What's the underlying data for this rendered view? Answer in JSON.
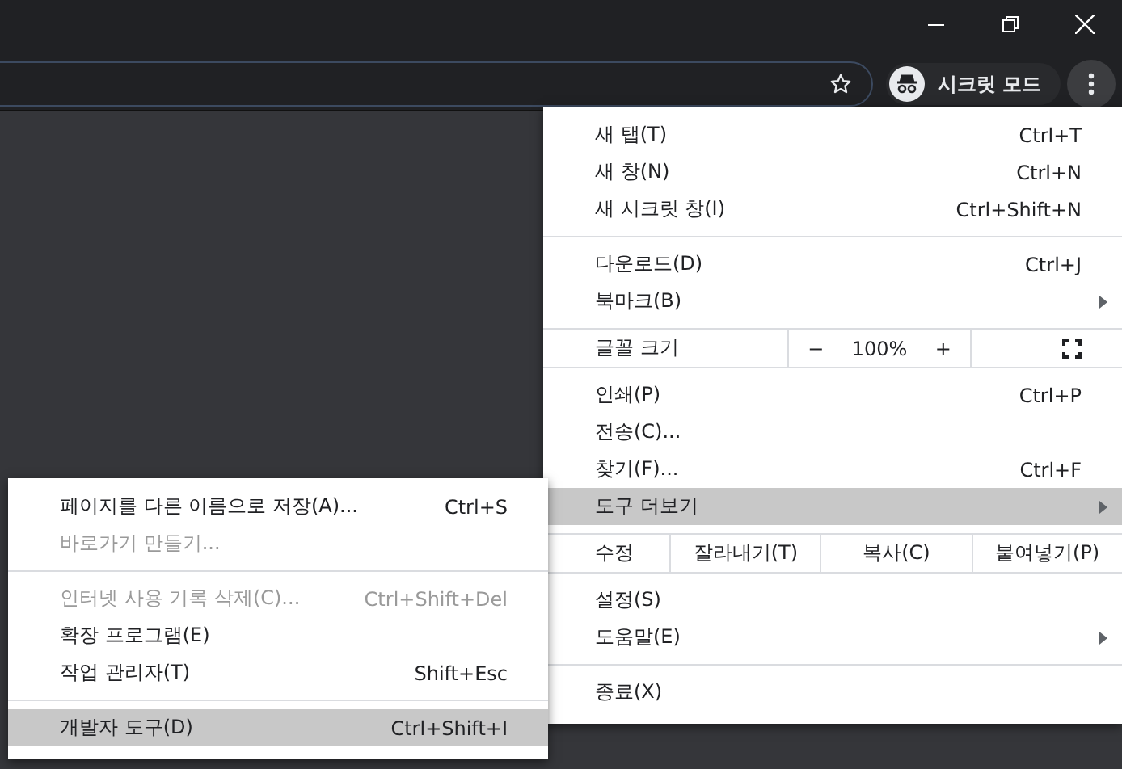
{
  "toolbar": {
    "incognito_label": "시크릿 모드"
  },
  "menu": {
    "sections": [
      [
        {
          "kind": "item",
          "label": "새 탭(T)",
          "shortcut": "Ctrl+T",
          "selected": false
        },
        {
          "kind": "item",
          "label": "새 창(N)",
          "shortcut": "Ctrl+N",
          "selected": false
        },
        {
          "kind": "item",
          "label": "새 시크릿 창(I)",
          "shortcut": "Ctrl+Shift+N",
          "selected": false
        }
      ],
      [
        {
          "kind": "item",
          "label": "다운로드(D)",
          "shortcut": "Ctrl+J",
          "selected": false
        },
        {
          "kind": "item",
          "label": "북마크(B)",
          "has_submenu": true,
          "selected": false
        }
      ],
      [
        {
          "kind": "zoom",
          "label": "글꼴 크기",
          "minus": "−",
          "value": "100%",
          "plus": "+"
        }
      ],
      [
        {
          "kind": "item",
          "label": "인쇄(P)",
          "shortcut": "Ctrl+P",
          "selected": false
        },
        {
          "kind": "item",
          "label": "전송(C)...",
          "selected": false
        },
        {
          "kind": "item",
          "label": "찾기(F)...",
          "shortcut": "Ctrl+F",
          "selected": false
        },
        {
          "kind": "item",
          "label": "도구 더보기",
          "has_submenu": true,
          "selected": true
        }
      ],
      [
        {
          "kind": "edit",
          "label": "수정",
          "buttons": [
            "잘라내기(T)",
            "복사(C)",
            "붙여넣기(P)"
          ]
        }
      ],
      [
        {
          "kind": "item",
          "label": "설정(S)",
          "selected": false
        },
        {
          "kind": "item",
          "label": "도움말(E)",
          "has_submenu": true,
          "selected": false
        }
      ],
      [
        {
          "kind": "item",
          "label": "종료(X)",
          "selected": false
        }
      ]
    ]
  },
  "submenu": {
    "sections": [
      [
        {
          "kind": "item",
          "label": "페이지를 다른 이름으로 저장(A)...",
          "shortcut": "Ctrl+S",
          "disabled": false,
          "selected": false
        },
        {
          "kind": "item",
          "label": "바로가기 만들기...",
          "disabled": true,
          "selected": false
        }
      ],
      [
        {
          "kind": "item",
          "label": "인터넷 사용 기록 삭제(C)...",
          "shortcut": "Ctrl+Shift+Del",
          "disabled": true,
          "selected": false
        },
        {
          "kind": "item",
          "label": "확장 프로그램(E)",
          "disabled": false,
          "selected": false
        },
        {
          "kind": "item",
          "label": "작업 관리자(T)",
          "shortcut": "Shift+Esc",
          "disabled": false,
          "selected": false
        }
      ],
      [
        {
          "kind": "item",
          "label": "개발자 도구(D)",
          "shortcut": "Ctrl+Shift+I",
          "disabled": false,
          "selected": true
        }
      ]
    ]
  }
}
